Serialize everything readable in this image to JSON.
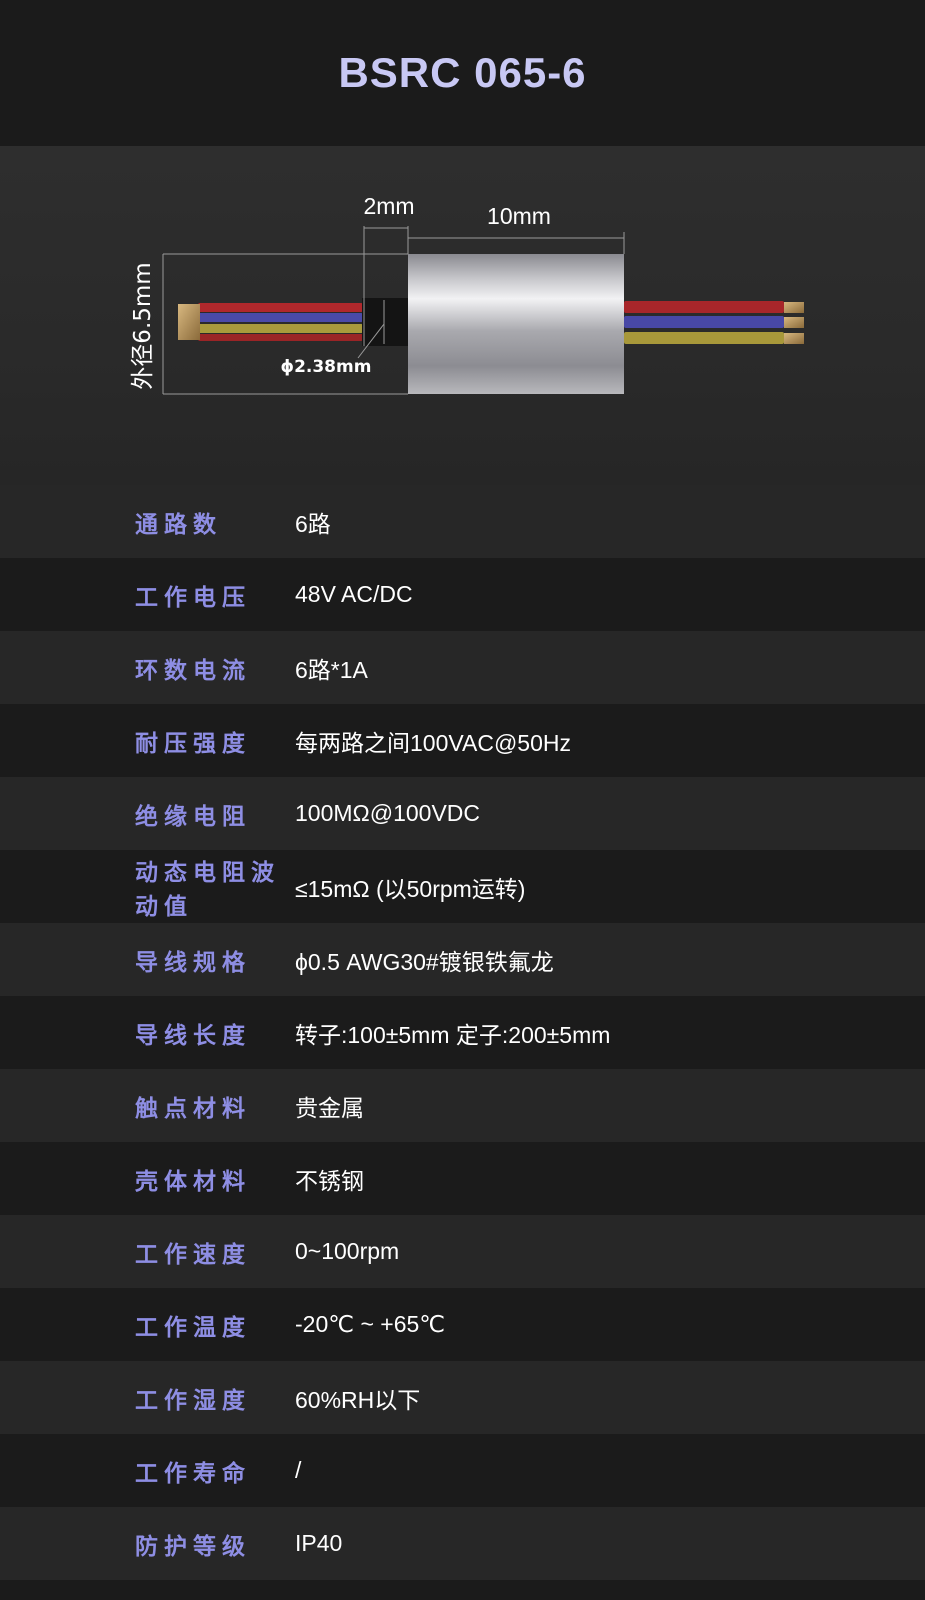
{
  "title": "BSRC 065-6",
  "figure": {
    "dim_top_small": "2mm",
    "dim_top_large": "10mm",
    "dim_vertical": "外径6.5mm",
    "dim_inner": "ϕ2.38mm"
  },
  "specs": [
    {
      "label": "通路数",
      "value": "6路"
    },
    {
      "label": "工作电压",
      "value": "48V AC/DC"
    },
    {
      "label": "环数电流",
      "value": "6路*1A"
    },
    {
      "label": "耐压强度",
      "value": "每两路之间100VAC@50Hz"
    },
    {
      "label": "绝缘电阻",
      "value": "100MΩ@100VDC"
    },
    {
      "label": "动态电阻波动值",
      "value": "≤15mΩ (以50rpm运转)"
    },
    {
      "label": "导线规格",
      "value": "ϕ0.5 AWG30#镀银铁氟龙"
    },
    {
      "label": "导线长度",
      "value": "转子:100±5mm  定子:200±5mm"
    },
    {
      "label": "触点材料",
      "value": "贵金属"
    },
    {
      "label": "壳体材料",
      "value": "不锈钢"
    },
    {
      "label": "工作速度",
      "value": "0~100rpm"
    },
    {
      "label": "工作温度",
      "value": "-20℃ ~ +65℃"
    },
    {
      "label": "工作湿度",
      "value": "60%RH以下"
    },
    {
      "label": "工作寿命",
      "value": "/"
    },
    {
      "label": "防护等级",
      "value": "IP40"
    }
  ]
}
